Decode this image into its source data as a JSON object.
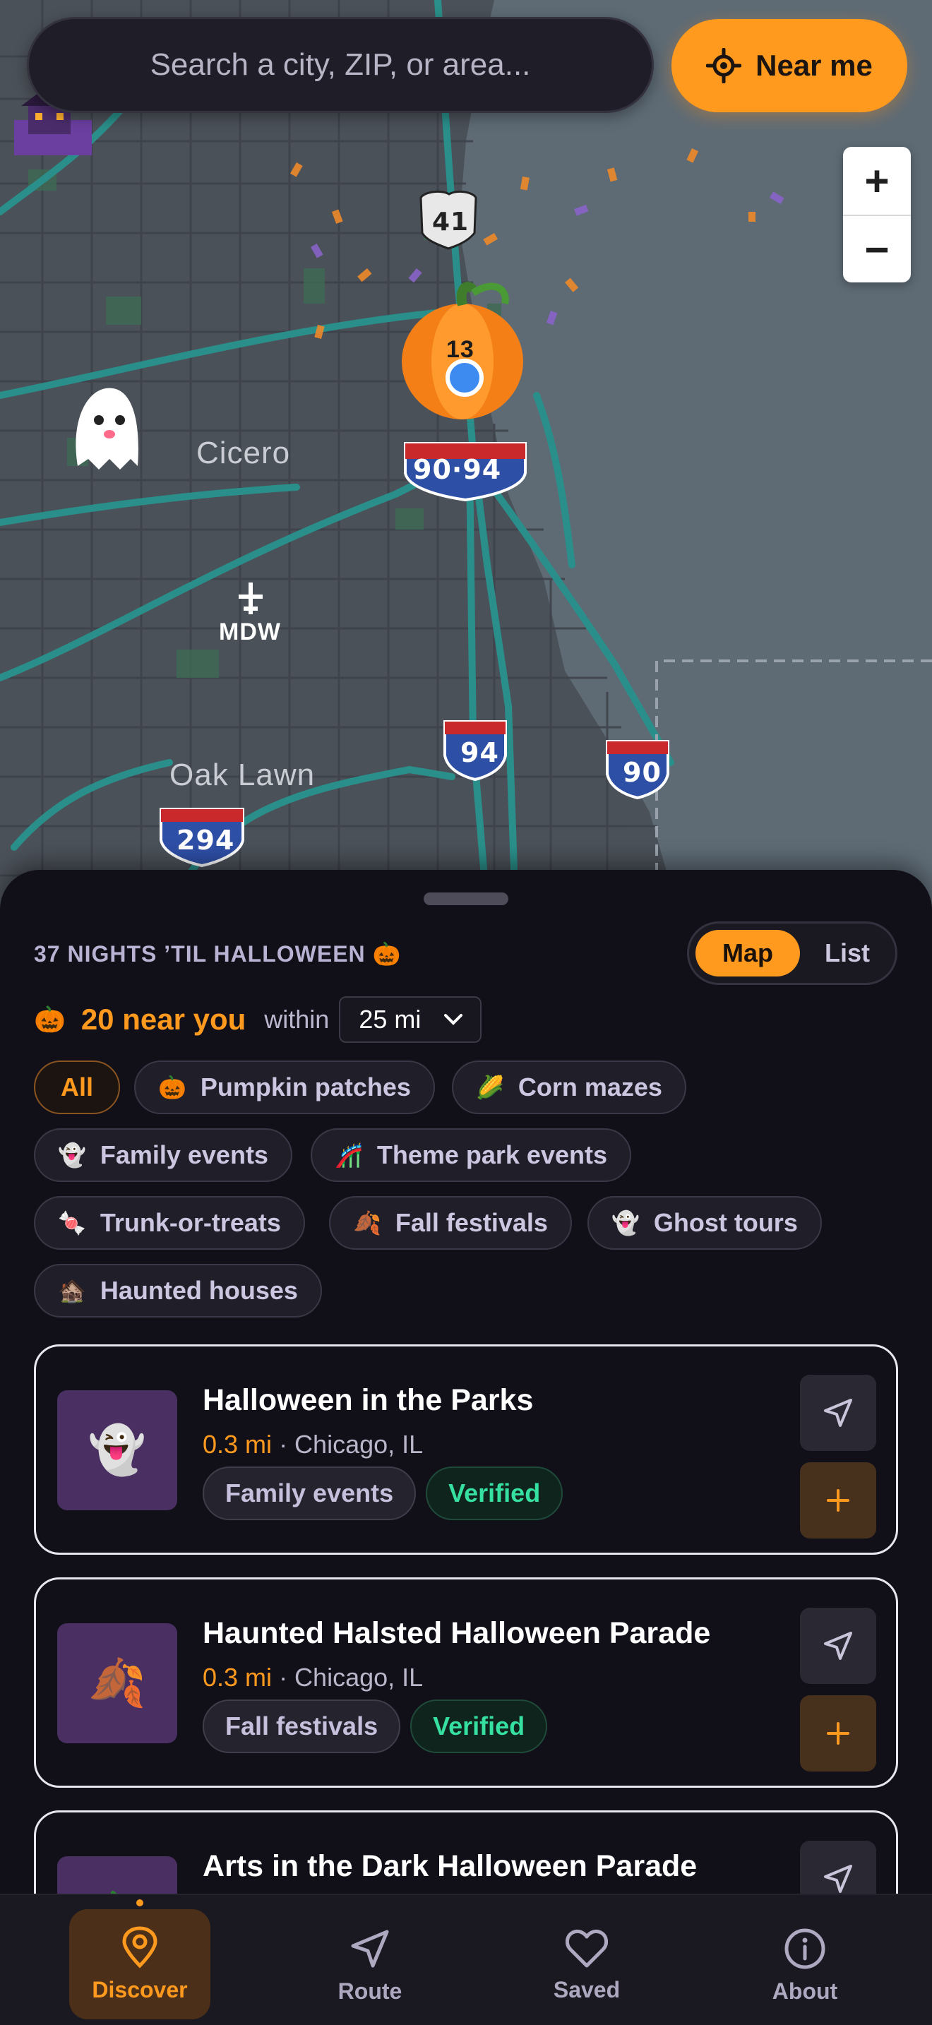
{
  "search": {
    "placeholder": "Search a city, ZIP, or area..."
  },
  "near_me": {
    "label": "Near me"
  },
  "zoom": {
    "in": "+",
    "out": "−"
  },
  "map": {
    "places": [
      "Cicero",
      "Oak Lawn"
    ],
    "airport": "MDW",
    "shields": {
      "us41": "41",
      "i9094": "90·94",
      "i94": "94",
      "i90": "90",
      "i294": "294"
    },
    "pumpkin_count": "13"
  },
  "sheet": {
    "countdown": "37 NIGHTS ’TIL HALLOWEEN 🎃",
    "view_toggle": {
      "map": "Map",
      "list": "List",
      "selected": "Map"
    },
    "near": {
      "emoji": "🎃",
      "count": "20 near you",
      "within": "within",
      "radius": "25 mi"
    },
    "chips": [
      {
        "emoji": "",
        "label": "All",
        "active": true
      },
      {
        "emoji": "🎃",
        "label": "Pumpkin patches"
      },
      {
        "emoji": "🌽",
        "label": "Corn mazes"
      },
      {
        "emoji": "👻",
        "label": "Family events"
      },
      {
        "emoji": "🎢",
        "label": "Theme park events"
      },
      {
        "emoji": "🍬",
        "label": "Trunk-or-treats"
      },
      {
        "emoji": "🍂",
        "label": "Fall festivals"
      },
      {
        "emoji": "👻",
        "label": "Ghost tours"
      },
      {
        "emoji": "🏚️",
        "label": "Haunted houses"
      }
    ],
    "cards": [
      {
        "emoji": "👻",
        "title": "Halloween in the Parks",
        "distance": "0.3 mi",
        "location": "· Chicago, IL",
        "category": "Family events",
        "badge": "Verified"
      },
      {
        "emoji": "🍂",
        "title": "Haunted Halsted Halloween Parade",
        "distance": "0.3 mi",
        "location": "· Chicago, IL",
        "category": "Fall festivals",
        "badge": "Verified"
      },
      {
        "emoji": "🎃",
        "title": "Arts in the Dark Halloween Parade",
        "distance": "",
        "location": "",
        "category": "",
        "badge": ""
      }
    ]
  },
  "tabbar": {
    "discover": "Discover",
    "route": "Route",
    "saved": "Saved",
    "about": "About",
    "active": "Discover"
  },
  "colors": {
    "accent": "#ff9a1f",
    "verified": "#36e0a0",
    "background": "#111019",
    "map_road": "#2a8f8a"
  }
}
